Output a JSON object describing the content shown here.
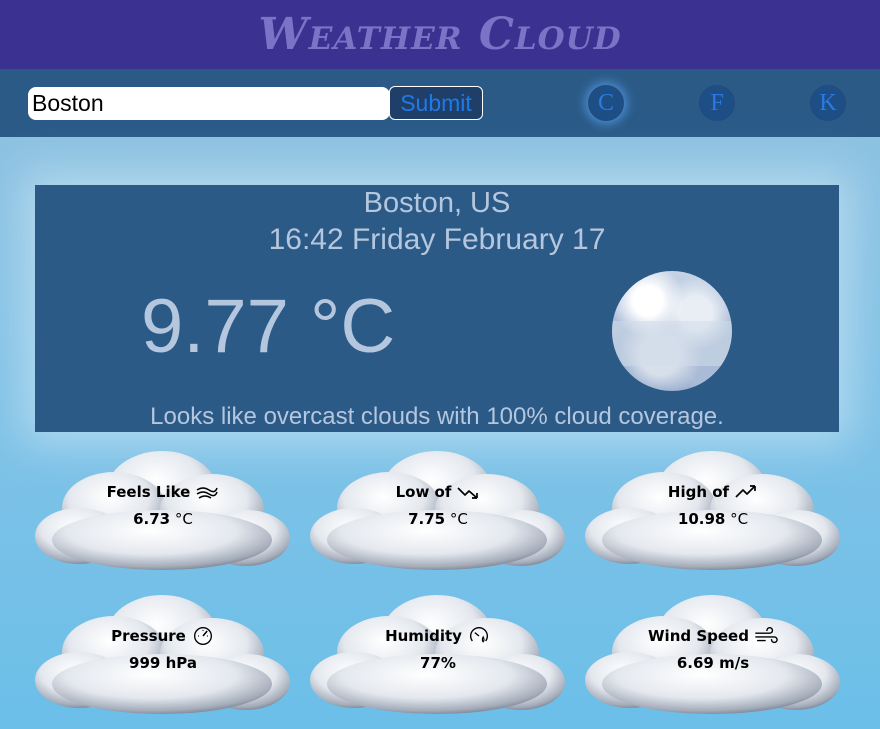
{
  "header": {
    "brand": "Weather Cloud"
  },
  "search": {
    "value": "Boston",
    "submit_label": "Submit"
  },
  "units": [
    {
      "label": "C",
      "active": true
    },
    {
      "label": "F",
      "active": false
    },
    {
      "label": "K",
      "active": false
    }
  ],
  "current": {
    "location": "Boston, US",
    "datetime": "16:42 Friday February 17",
    "temperature": "9.77 °C",
    "description": "Looks like overcast clouds with 100% cloud coverage.",
    "icon": "overcast-clouds-icon"
  },
  "stats": [
    {
      "title": "Feels Like",
      "icon": "feels-like-wind-icon",
      "value": "6.73",
      "unit": "°C"
    },
    {
      "title": "Low of",
      "icon": "trend-down-icon",
      "value": "7.75",
      "unit": "°C"
    },
    {
      "title": "High of",
      "icon": "trend-up-icon",
      "value": "10.98",
      "unit": "°C"
    },
    {
      "title": "Pressure",
      "icon": "gauge-icon",
      "value": "999 hPa",
      "unit": ""
    },
    {
      "title": "Humidity",
      "icon": "humidity-gauge-icon",
      "value": "77%",
      "unit": ""
    },
    {
      "title": "Wind Speed",
      "icon": "wind-icon",
      "value": "6.69 m/s",
      "unit": ""
    }
  ],
  "colors": {
    "header_bg": "#3b3190",
    "brand": "#7b74c6",
    "toolbar_bg": "#2b5a87",
    "panel_bg": "#2b5a87",
    "panel_text": "#b5c7de",
    "unit_btn": "#1d4f86"
  }
}
